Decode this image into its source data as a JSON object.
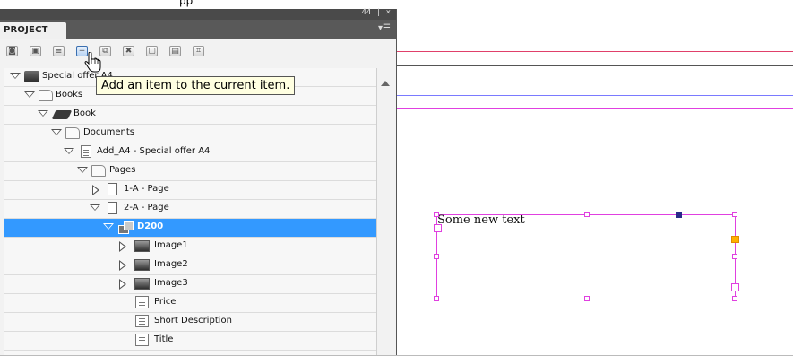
{
  "top_strip": {
    "text": "pp"
  },
  "panel": {
    "title_controls": "44 | ×",
    "tab_label": "PROJECT",
    "tab_close": "×",
    "menu_icon": "hamburger-menu-icon",
    "toolbar": [
      "view-icon",
      "save-icon",
      "properties-icon",
      "add-item-icon",
      "copy-icon",
      "delete-icon",
      "frame-icon",
      "preview-icon",
      "export-icon"
    ],
    "tooltip": "Add an item to the current item."
  },
  "tree": {
    "rows": [
      {
        "label": "Special offer A4",
        "icon": "catalog-icon",
        "expanded": true
      },
      {
        "label": "Books",
        "icon": "folder-icon",
        "expanded": true
      },
      {
        "label": "Book",
        "icon": "book-icon",
        "expanded": true
      },
      {
        "label": "Documents",
        "icon": "folder-icon",
        "expanded": true
      },
      {
        "label": "Add_A4 - Special offer A4",
        "icon": "document-icon",
        "expanded": true
      },
      {
        "label": "Pages",
        "icon": "folder-icon",
        "expanded": true
      },
      {
        "label": "1-A - Page",
        "icon": "page-icon",
        "expanded": false
      },
      {
        "label": "2-A - Page",
        "icon": "page-icon",
        "expanded": true
      },
      {
        "label": "D200",
        "icon": "group-icon",
        "expanded": true,
        "selected": true
      },
      {
        "label": "Image1",
        "icon": "image-icon",
        "expanded": false
      },
      {
        "label": "Image2",
        "icon": "image-icon",
        "expanded": false
      },
      {
        "label": "Image3",
        "icon": "image-icon",
        "expanded": false
      },
      {
        "label": "Price",
        "icon": "text-field-icon"
      },
      {
        "label": "Short Description",
        "icon": "text-field-icon"
      },
      {
        "label": "Title",
        "icon": "text-field-icon"
      }
    ]
  },
  "canvas": {
    "frame_text": "Some new text",
    "colors": {
      "guide_pink": "#e0406a",
      "guide_blue": "#7a7aff",
      "guide_magenta": "#e040e0",
      "frame_border": "#e040e0",
      "handle_selected": "#2a2a8a",
      "handle_yellow": "#ffb000"
    }
  },
  "colors": {
    "selection": "#3399ff",
    "panel_bg": "#f2f2f2",
    "titlebar": "#4a4a4a",
    "tooltip_bg": "#ffffe1"
  }
}
